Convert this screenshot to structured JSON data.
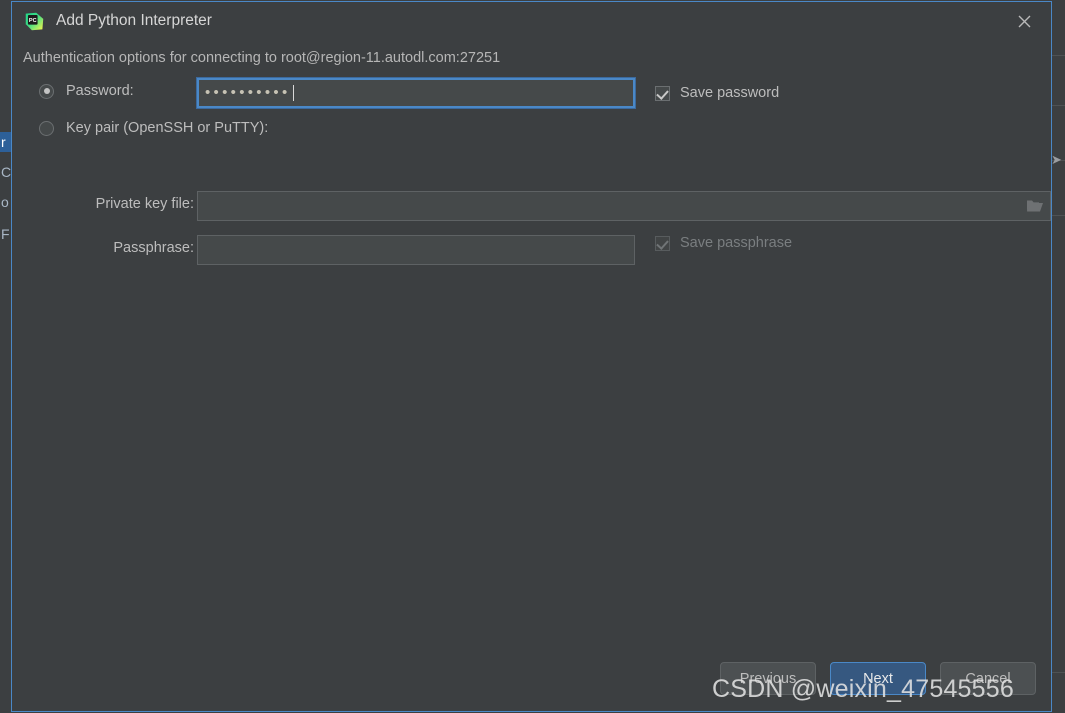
{
  "window": {
    "title": "Add Python Interpreter",
    "app_icon": "pycharm-icon",
    "close_icon": "close-icon"
  },
  "dialog": {
    "subtitle": "Authentication options for connecting to root@region-11.autodl.com:27251",
    "auth_method": "password",
    "options": {
      "password": {
        "label": "Password:",
        "selected": true,
        "value": "••••••••••",
        "masked_length": 10,
        "focused": true
      },
      "key_pair": {
        "label": "Key pair (OpenSSH or PuTTY):",
        "selected": false
      }
    },
    "fields": {
      "private_key_file": {
        "label": "Private key file:",
        "value": "",
        "placeholder": "",
        "browse_icon": "folder-icon",
        "enabled": false
      },
      "passphrase": {
        "label": "Passphrase:",
        "value": "",
        "placeholder": "",
        "enabled": false
      }
    },
    "checkboxes": {
      "save_password": {
        "label": "Save password",
        "checked": true,
        "enabled": true
      },
      "save_passphrase": {
        "label": "Save passphrase",
        "checked": true,
        "enabled": false
      }
    },
    "buttons": {
      "previous": "Previous",
      "next": "Next",
      "cancel": "Cancel"
    }
  },
  "background": {
    "left_strip_items": [
      {
        "text": "r",
        "selected": true
      },
      {
        "text": "C",
        "selected": false
      },
      {
        "text": "o",
        "selected": false
      },
      {
        "text": "F",
        "selected": false
      }
    ],
    "collapse_icon": "chevron-right-icon"
  },
  "watermark": {
    "text": "CSDN @weixin_47545556"
  },
  "colors": {
    "dialog_background": "#3c3f41",
    "field_background": "#45494a",
    "accent_blue": "#4a88c7",
    "primary_button": "#365880",
    "text": "#bdbdbd",
    "disabled_text": "#7a7e80"
  }
}
